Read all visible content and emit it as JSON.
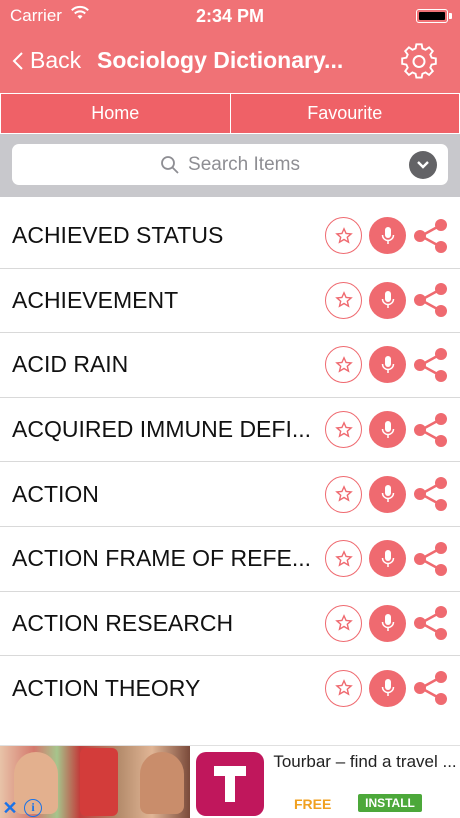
{
  "status_bar": {
    "carrier": "Carrier",
    "time": "2:34 PM"
  },
  "nav": {
    "back_label": "Back",
    "title": "Sociology Dictionary..."
  },
  "tabs": [
    {
      "label": "Home"
    },
    {
      "label": "Favourite"
    }
  ],
  "search": {
    "placeholder": "Search Items"
  },
  "list": {
    "items": [
      {
        "label": "ACHIEVED STATUS"
      },
      {
        "label": "ACHIEVEMENT"
      },
      {
        "label": "ACID RAIN"
      },
      {
        "label": "ACQUIRED IMMUNE DEFI..."
      },
      {
        "label": "ACTION"
      },
      {
        "label": "ACTION FRAME OF REFE..."
      },
      {
        "label": "ACTION RESEARCH"
      },
      {
        "label": "ACTION THEORY"
      }
    ]
  },
  "ad": {
    "title": "Tourbar – find a travel ...",
    "free_label": "FREE",
    "install_label": "INSTALL"
  },
  "colors": {
    "accent": "#f07276",
    "search_bg": "#c8c8cc",
    "install_green": "#4ca83a"
  },
  "icons": {
    "settings": "gear-icon",
    "favourite": "star-icon",
    "speak": "mic-icon",
    "share": "share-icon"
  }
}
